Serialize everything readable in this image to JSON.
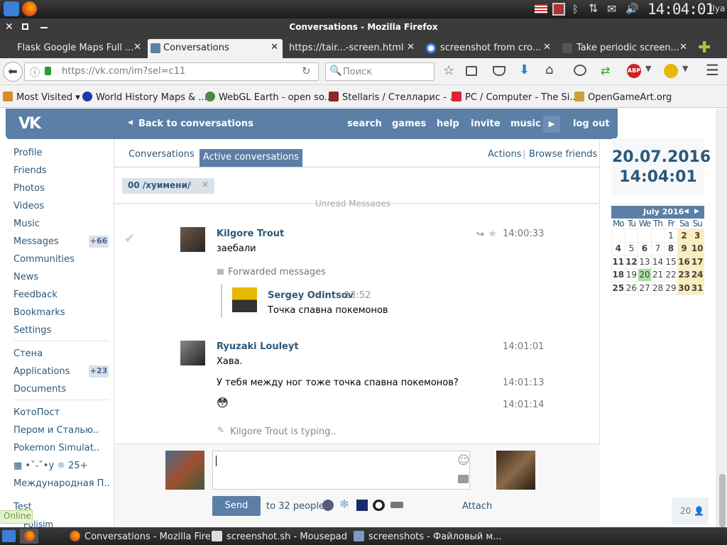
{
  "system": {
    "clock": "14:04:01",
    "user": "Ilya"
  },
  "window": {
    "title": "Conversations - Mozilla Firefox"
  },
  "tabs": [
    {
      "label": "Flask Google Maps Full ..."
    },
    {
      "label": "Conversations"
    },
    {
      "label": "https://tair...-screen.html"
    },
    {
      "label": "screenshot from cro..."
    },
    {
      "label": "Take periodic screen..."
    }
  ],
  "nav": {
    "url": "https://vk.com/im?sel=c11",
    "search_placeholder": "Поиск"
  },
  "bookmarks": [
    {
      "label": "Most Visited ▾"
    },
    {
      "label": "World History Maps & ..."
    },
    {
      "label": "WebGL Earth - open so..."
    },
    {
      "label": "Stellaris / Стелларис - ..."
    },
    {
      "label": "PC / Computer - The Si..."
    },
    {
      "label": "OpenGameArt.org"
    }
  ],
  "vk": {
    "logo": "VK",
    "back": "Back to conversations",
    "menu": {
      "search": "search",
      "games": "games",
      "help": "help",
      "invite": "invite",
      "music": "music",
      "logout": "log out"
    }
  },
  "sidebar": {
    "items": [
      {
        "label": "Profile"
      },
      {
        "label": "Friends"
      },
      {
        "label": "Photos"
      },
      {
        "label": "Videos"
      },
      {
        "label": "Music"
      },
      {
        "label": "Messages",
        "badge": "+66"
      },
      {
        "label": "Communities"
      },
      {
        "label": "News"
      },
      {
        "label": "Feedback"
      },
      {
        "label": "Bookmarks"
      },
      {
        "label": "Settings"
      },
      {
        "label": "Стена"
      },
      {
        "label": "Applications",
        "badge": "+23"
      },
      {
        "label": "Documents"
      },
      {
        "label": "КотоПост"
      },
      {
        "label": "Пером и Сталью.."
      },
      {
        "label": "Pokemon Simulat.."
      },
      {
        "label": "▦ •ˇ-ˇ•у ☼ 25+"
      },
      {
        "label": "Международная П.."
      },
      {
        "label": "Test"
      },
      {
        "label": "Polisim"
      }
    ],
    "online": "Online"
  },
  "conv": {
    "tab_conversations": "Conversations",
    "tab_active": "Active conversations",
    "actions": "Actions",
    "separator": "|",
    "browse": "Browse friends",
    "chip": "00 /хуимени/",
    "unread": "Unread Messages",
    "messages": [
      {
        "name": "Kilgore Trout",
        "time": "14:00:33",
        "text": "заебали"
      },
      {
        "forwarded_label": "Forwarded messages",
        "fwd_name": "Sergey Odintsov",
        "fwd_time": "13:52",
        "fwd_text": "Точка спавна покемонов"
      },
      {
        "name": "Ryuzaki Louleyt",
        "time": "14:01:01",
        "text": "Хава."
      },
      {
        "text": "У тебя между ног тоже точка спавна покемонов?",
        "time": "14:01:13"
      },
      {
        "text": "😳",
        "time": "14:01:14"
      }
    ],
    "typing": "Kilgore Trout is typing..",
    "send": "Send",
    "to_people": "to 32 people",
    "attach": "Attach"
  },
  "right": {
    "date": "20.07.2016",
    "time": "14:04:01",
    "cal_title": "July 2016",
    "weekdays": [
      "Mo",
      "Tu",
      "We",
      "Th",
      "Fr",
      "Sa",
      "Su"
    ],
    "weeks": [
      [
        "",
        "",
        "",
        "",
        "1",
        "2",
        "3"
      ],
      [
        "4",
        "5",
        "6",
        "7",
        "8",
        "9",
        "10"
      ],
      [
        "11",
        "12",
        "13",
        "14",
        "15",
        "16",
        "17"
      ],
      [
        "18",
        "19",
        "20",
        "21",
        "22",
        "23",
        "24"
      ],
      [
        "25",
        "26",
        "27",
        "28",
        "29",
        "30",
        "31"
      ]
    ],
    "today": "20",
    "counter": "20"
  },
  "taskbar": [
    {
      "label": "Conversations - Mozilla Fire..."
    },
    {
      "label": "screenshot.sh - Mousepad"
    },
    {
      "label": "screenshots - Файловый м..."
    }
  ],
  "colors": {
    "vk_blue": "#5b7fa6",
    "link": "#2b587a",
    "weekend": "#fbeeb6",
    "today": "#a8e2a0"
  }
}
